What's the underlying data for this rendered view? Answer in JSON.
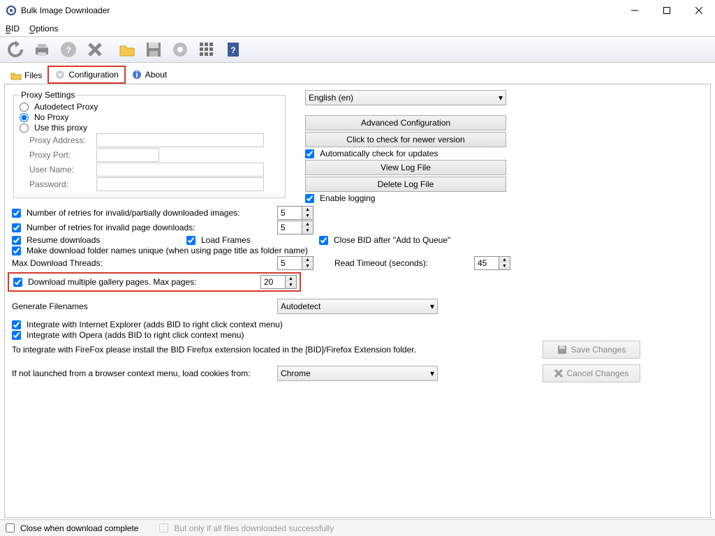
{
  "window": {
    "title": "Bulk Image Downloader"
  },
  "menu": {
    "bid": "BID",
    "options": "Options"
  },
  "tabs": {
    "files": "Files",
    "config": "Configuration",
    "about": "About"
  },
  "proxy": {
    "legend": "Proxy Settings",
    "auto": "Autodetect Proxy",
    "none": "No Proxy",
    "use": "Use this proxy",
    "addr": "Proxy Address:",
    "port": "Proxy Port:",
    "user": "User Name:",
    "pass": "Password:"
  },
  "right": {
    "lang": "English (en)",
    "advcfg": "Advanced Configuration",
    "checkver": "Click to check for newer version",
    "autocheck": "Automatically check for updates",
    "viewlog": "View Log File",
    "dellog": "Delete Log File",
    "enablelog": "Enable logging"
  },
  "opts": {
    "retries_img": "Number of retries for invalid/partially downloaded images:",
    "retries_img_v": "5",
    "retries_page": "Number of retries for invalid page downloads:",
    "retries_page_v": "5",
    "resume": "Resume downloads",
    "loadframes": "Load Frames",
    "closebid": "Close BID after \"Add to Queue\"",
    "unique": "Make download folder names unique (when using page title as folder name)",
    "maxthreads": "Max Download Threads:",
    "maxthreads_v": "5",
    "readto": "Read Timeout (seconds):",
    "readto_v": "45",
    "multipage": "Download multiple gallery pages. Max pages:",
    "multipage_v": "20",
    "genfn": "Generate Filenames",
    "genfn_v": "Autodetect",
    "ie": "Integrate with Internet Explorer (adds BID to right click context menu)",
    "opera": "Integrate with Opera (adds BID to right click context menu)",
    "ff": "To integrate with FireFox please install the BID Firefox extension located in the [BID]/Firefox Extension folder.",
    "cookies": "If not launched from a browser context menu, load cookies from:",
    "cookies_v": "Chrome",
    "save": "Save Changes",
    "cancel": "Cancel Changes"
  },
  "footer": {
    "close": "Close when download complete",
    "butonly": "But only if all files downloaded successfully"
  }
}
